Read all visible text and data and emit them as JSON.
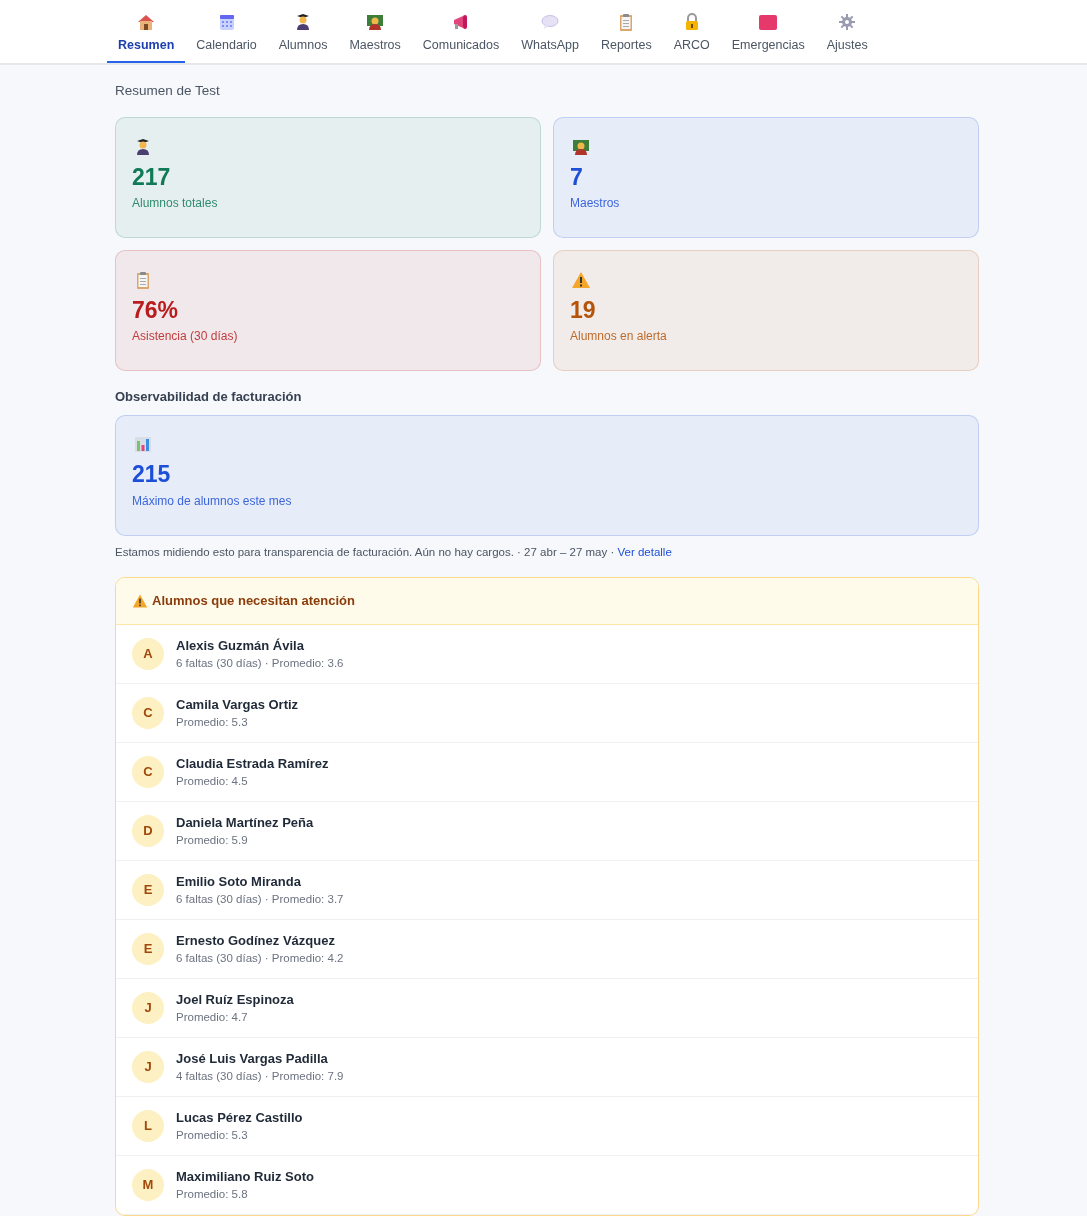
{
  "tabs": [
    {
      "label": "Resumen",
      "selected": true
    },
    {
      "label": "Calendario",
      "selected": false
    },
    {
      "label": "Alumnos",
      "selected": false
    },
    {
      "label": "Maestros",
      "selected": false
    },
    {
      "label": "Comunicados",
      "selected": false
    },
    {
      "label": "WhatsApp",
      "selected": false
    },
    {
      "label": "Reportes",
      "selected": false
    },
    {
      "label": "ARCO",
      "selected": false
    },
    {
      "label": "Emergencias",
      "selected": false
    },
    {
      "label": "Ajustes",
      "selected": false
    }
  ],
  "page_title": "Resumen de Test",
  "stats": [
    {
      "value": "217",
      "label": "Alumnos totales",
      "color": "#0f7a55"
    },
    {
      "value": "7",
      "label": "Maestros",
      "color": "#1d4ed8"
    },
    {
      "value": "76%",
      "label": "Asistencia (30 días)",
      "color": "#b91c1c"
    },
    {
      "value": "19",
      "label": "Alumnos en alerta",
      "color": "#b45309"
    }
  ],
  "billing": {
    "heading": "Observabilidad de facturación",
    "value": "215",
    "label": "Máximo de alumnos este mes",
    "color": "#1d4ed8",
    "note": "Estamos midiendo esto para transparencia de facturación. Aún no hay cargos. · 27 abr – 27 may ·",
    "link": "Ver detalle"
  },
  "attention": {
    "title": "Alumnos que necesitan atención",
    "students": [
      {
        "initial": "A",
        "name": "Alexis Guzmán Ávila",
        "detail": "6 faltas (30 días) · Promedio: 3.6"
      },
      {
        "initial": "C",
        "name": "Camila Vargas Ortiz",
        "detail": "Promedio: 5.3"
      },
      {
        "initial": "C",
        "name": "Claudia Estrada Ramírez",
        "detail": "Promedio: 4.5"
      },
      {
        "initial": "D",
        "name": "Daniela Martínez Peña",
        "detail": "Promedio: 5.9"
      },
      {
        "initial": "E",
        "name": "Emilio Soto Miranda",
        "detail": "6 faltas (30 días) · Promedio: 3.7"
      },
      {
        "initial": "E",
        "name": "Ernesto Godínez Vázquez",
        "detail": "6 faltas (30 días) · Promedio: 4.2"
      },
      {
        "initial": "J",
        "name": "Joel Ruíz Espinoza",
        "detail": "Promedio: 4.7"
      },
      {
        "initial": "J",
        "name": "José Luis Vargas Padilla",
        "detail": "4 faltas (30 días) · Promedio: 7.9"
      },
      {
        "initial": "L",
        "name": "Lucas Pérez Castillo",
        "detail": "Promedio: 5.3"
      },
      {
        "initial": "M",
        "name": "Maximiliano Ruiz Soto",
        "detail": "Promedio: 5.8"
      }
    ]
  }
}
